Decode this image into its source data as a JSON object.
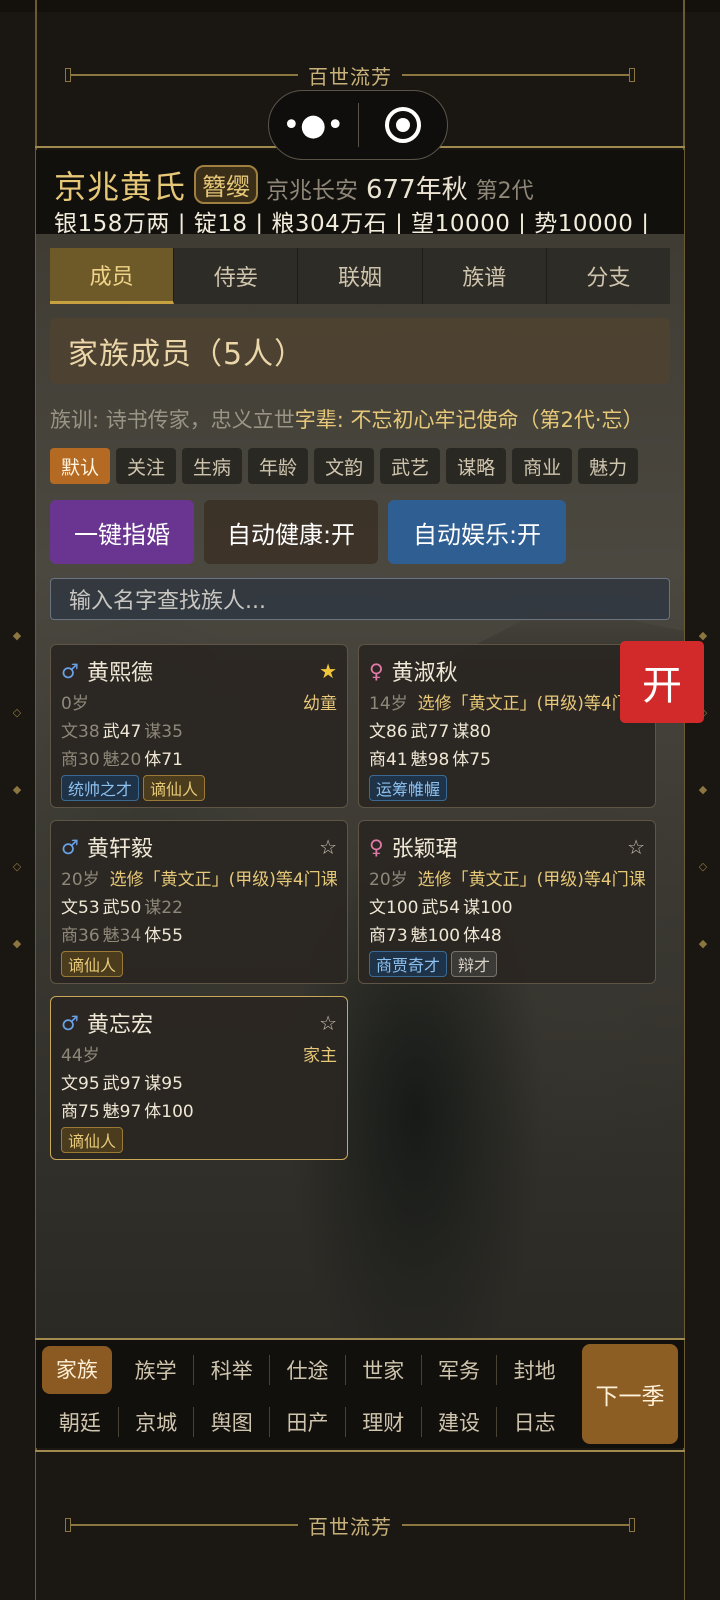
{
  "banner": {
    "text": "百世流芳"
  },
  "header": {
    "clan": "京兆黄氏",
    "rank": "簪缨",
    "location": "京兆长安",
    "year": "677年秋",
    "generation": "第2代",
    "resources": "银158万两 | 锭18 | 粮304万石 | 望10000 | 势10000 |"
  },
  "tabs": [
    "成员",
    "侍妾",
    "联姻",
    "族谱",
    "分支"
  ],
  "section_title": "家族成员（5人）",
  "motto": {
    "clan_rule": "族训: 诗书传家，忠义立世",
    "generation_names": "字辈: 不忘初心牢记使命（第2代·忘）"
  },
  "filters": [
    "默认",
    "关注",
    "生病",
    "年龄",
    "文韵",
    "武艺",
    "谋略",
    "商业",
    "魅力"
  ],
  "actions": {
    "marry": "一键指婚",
    "auto_health": "自动健康:开",
    "auto_fun": "自动娱乐:开"
  },
  "search": {
    "placeholder": "输入名字查找族人..."
  },
  "floating_button": "开",
  "members": [
    {
      "sex": "♂",
      "name": "黄熙德",
      "star": "★",
      "age": "0岁",
      "role": "幼童",
      "wen": "文38",
      "wu": "武47",
      "mou": "谋35",
      "shang": "商30",
      "mei": "魅20",
      "ti": "体71",
      "tags": [
        "统帅之才",
        "谪仙人"
      ]
    },
    {
      "sex": "♀",
      "name": "黄淑秋",
      "star": "",
      "age": "14岁",
      "role": "选修「黄文正」(甲级)等4门课",
      "wen": "文86",
      "wu": "武77",
      "mou": "谋80",
      "shang": "商41",
      "mei": "魅98",
      "ti": "体75",
      "tags": [
        "运筹帷幄"
      ]
    },
    {
      "sex": "♂",
      "name": "黄轩毅",
      "star": "☆",
      "age": "20岁",
      "role": "选修「黄文正」(甲级)等4门课",
      "wen": "文53",
      "wu": "武50",
      "mou": "谋22",
      "shang": "商36",
      "mei": "魅34",
      "ti": "体55",
      "tags": [
        "谪仙人"
      ]
    },
    {
      "sex": "♀",
      "name": "张颖珺",
      "star": "☆",
      "age": "20岁",
      "role": "选修「黄文正」(甲级)等4门课",
      "wen": "文100",
      "wu": "武54",
      "mou": "谋100",
      "shang": "商73",
      "mei": "魅100",
      "ti": "体48",
      "tags": [
        "商贾奇才",
        "辩才"
      ]
    },
    {
      "sex": "♂",
      "name": "黄忘宏",
      "star": "☆",
      "age": "44岁",
      "role": "家主",
      "wen": "文95",
      "wu": "武97",
      "mou": "谋95",
      "shang": "商75",
      "mei": "魅97",
      "ti": "体100",
      "tags": [
        "谪仙人"
      ]
    }
  ],
  "bottom_nav": {
    "row1": [
      "家族",
      "族学",
      "科举",
      "仕途",
      "世家",
      "军务",
      "封地"
    ],
    "row2": [
      "朝廷",
      "京城",
      "舆图",
      "田产",
      "理财",
      "建设",
      "日志"
    ],
    "next": "下一季"
  }
}
